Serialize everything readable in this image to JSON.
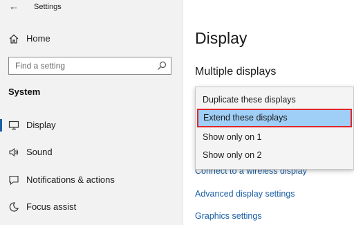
{
  "window": {
    "title": "Settings"
  },
  "sidebar": {
    "home_label": "Home",
    "search": {
      "placeholder": "Find a setting"
    },
    "section_title": "System",
    "items": [
      {
        "label": "Display",
        "icon": "monitor-icon",
        "selected": true
      },
      {
        "label": "Sound",
        "icon": "speaker-icon"
      },
      {
        "label": "Notifications & actions",
        "icon": "notification-icon"
      },
      {
        "label": "Focus assist",
        "icon": "moon-icon"
      }
    ]
  },
  "main": {
    "title": "Display",
    "subheading": "Multiple displays",
    "links": [
      "Connect to a wireless display",
      "Advanced display settings",
      "Graphics settings"
    ]
  },
  "dropdown": {
    "options": [
      "Duplicate these displays",
      "Extend these displays",
      "Show only on 1",
      "Show only on 2"
    ],
    "selected_index": 1
  },
  "colors": {
    "accent": "#1f5fa8",
    "link": "#1c5fa5",
    "selection_fill": "#9fcff7",
    "highlight_outline": "#e0242b"
  }
}
